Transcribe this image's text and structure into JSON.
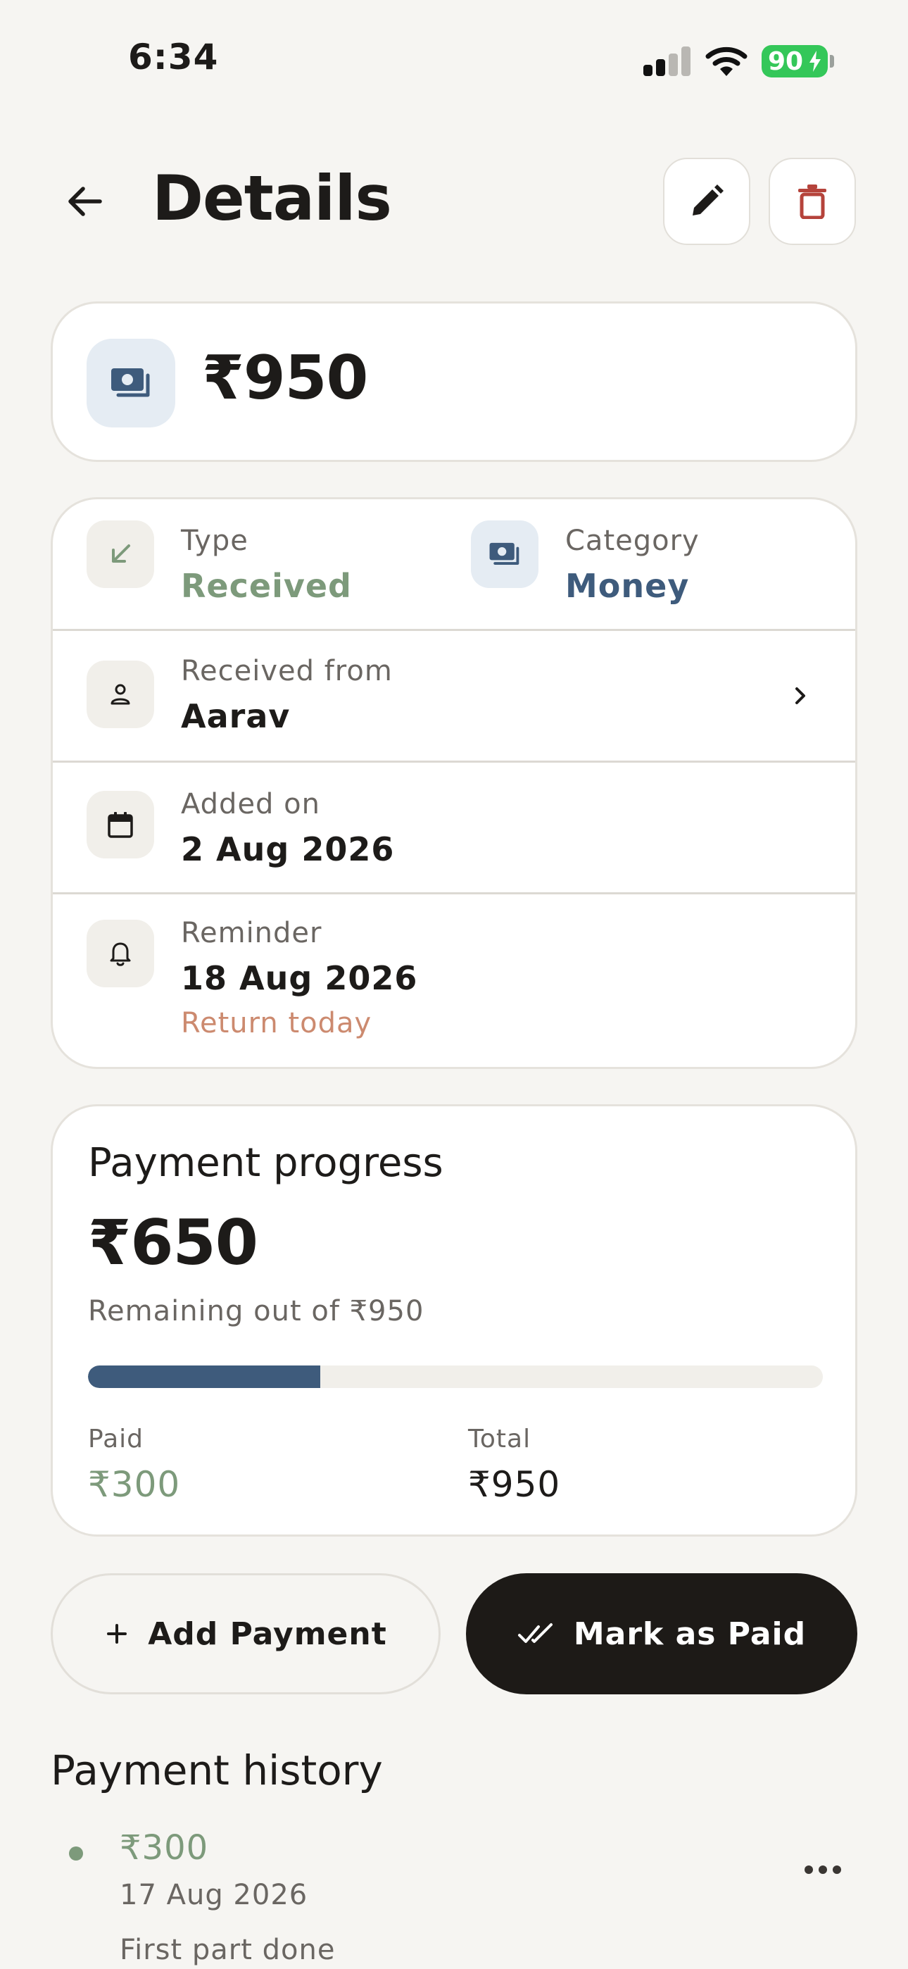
{
  "status_bar": {
    "time": "6:34",
    "battery_level": "90",
    "icons": [
      "cellular-signal-icon",
      "wifi-icon",
      "battery-charging-icon"
    ]
  },
  "header": {
    "title": "Details",
    "icons": [
      "arrow-left-icon",
      "pencil-icon",
      "trash-icon"
    ]
  },
  "amount_card": {
    "amount": "₹950",
    "icon": "money-icon"
  },
  "info": {
    "type_label": "Type",
    "type_value": "Received",
    "category_label": "Category",
    "category_value": "Money",
    "person_label": "Received from",
    "person_value": "Aarav",
    "added_label": "Added on",
    "added_value": "2 Aug 2026",
    "reminder_label": "Reminder",
    "reminder_value": "18 Aug 2026",
    "reminder_note": "Return today"
  },
  "progress": {
    "title": "Payment progress",
    "remaining": "₹650",
    "remaining_label": "Remaining out of ₹950",
    "paid_label": "Paid",
    "paid_value": "₹300",
    "total_label": "Total",
    "total_value": "₹950",
    "paid_fraction": 0.3158
  },
  "actions": {
    "add_payment": "Add Payment",
    "mark_paid": "Mark as Paid"
  },
  "history": {
    "title": "Payment history",
    "items": [
      {
        "amount": "₹300",
        "date": "17 Aug 2026",
        "note": "First part done"
      }
    ]
  },
  "colors": {
    "background": "#f6f5f2",
    "accent_blue": "#3e5b7c",
    "accent_green": "#7d9a7b",
    "reminder": "#cc8a6f",
    "danger": "#b5433b",
    "primary_button": "#1d1a17"
  }
}
